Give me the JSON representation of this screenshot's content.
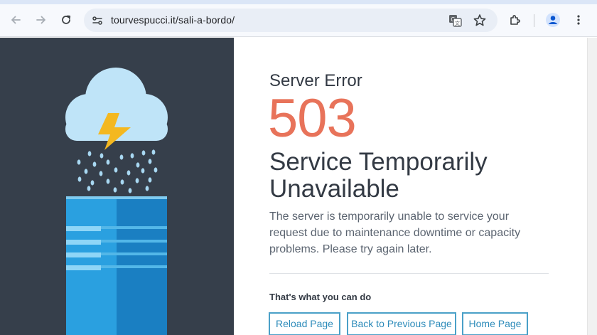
{
  "browser": {
    "url": "tourvespucci.it/sali-a-bordo/",
    "icons": [
      "back-arrow-icon",
      "forward-arrow-icon",
      "reload-icon",
      "site-info-icon",
      "translate-icon",
      "bookmark-star-icon",
      "extensions-icon",
      "profile-avatar-icon",
      "menu-kebab-icon"
    ]
  },
  "error": {
    "label": "Server Error",
    "code": "503",
    "title": "Service Temporarily Unavailable",
    "message": "The server is temporarily unable to service your request due to maintenance downtime or capacity problems. Please try again later.",
    "actions_heading": "That's what you can do",
    "buttons": {
      "reload": "Reload Page",
      "back": "Back to Previous Page",
      "home": "Home Page"
    }
  },
  "colors": {
    "left_panel": "#363f4b",
    "error_code": "#e8735a",
    "button_border": "#4aa0c8",
    "cloud": "#bfe4f8",
    "lightning": "#f4b820",
    "server_light": "#2aa0e0",
    "server_dark": "#1a7fc2"
  }
}
